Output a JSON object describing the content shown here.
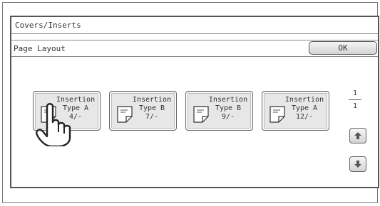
{
  "window": {
    "title": "Covers/Inserts"
  },
  "header": {
    "title": "Page Layout",
    "ok_label": "OK"
  },
  "tiles": [
    {
      "line1": "Insertion",
      "line2": "Type A",
      "count": "4/-"
    },
    {
      "line1": "Insertion",
      "line2": "Type B",
      "count": "7/-"
    },
    {
      "line1": "Insertion",
      "line2": "Type B",
      "count": "9/-"
    },
    {
      "line1": "Insertion",
      "line2": "Type A",
      "count": "12/-"
    }
  ],
  "pager": {
    "current": "1",
    "total": "1"
  },
  "icons": {
    "tile": "page-insert-icon",
    "up": "arrow-up-icon",
    "down": "arrow-down-icon",
    "pointer": "hand-pointer-icon"
  }
}
